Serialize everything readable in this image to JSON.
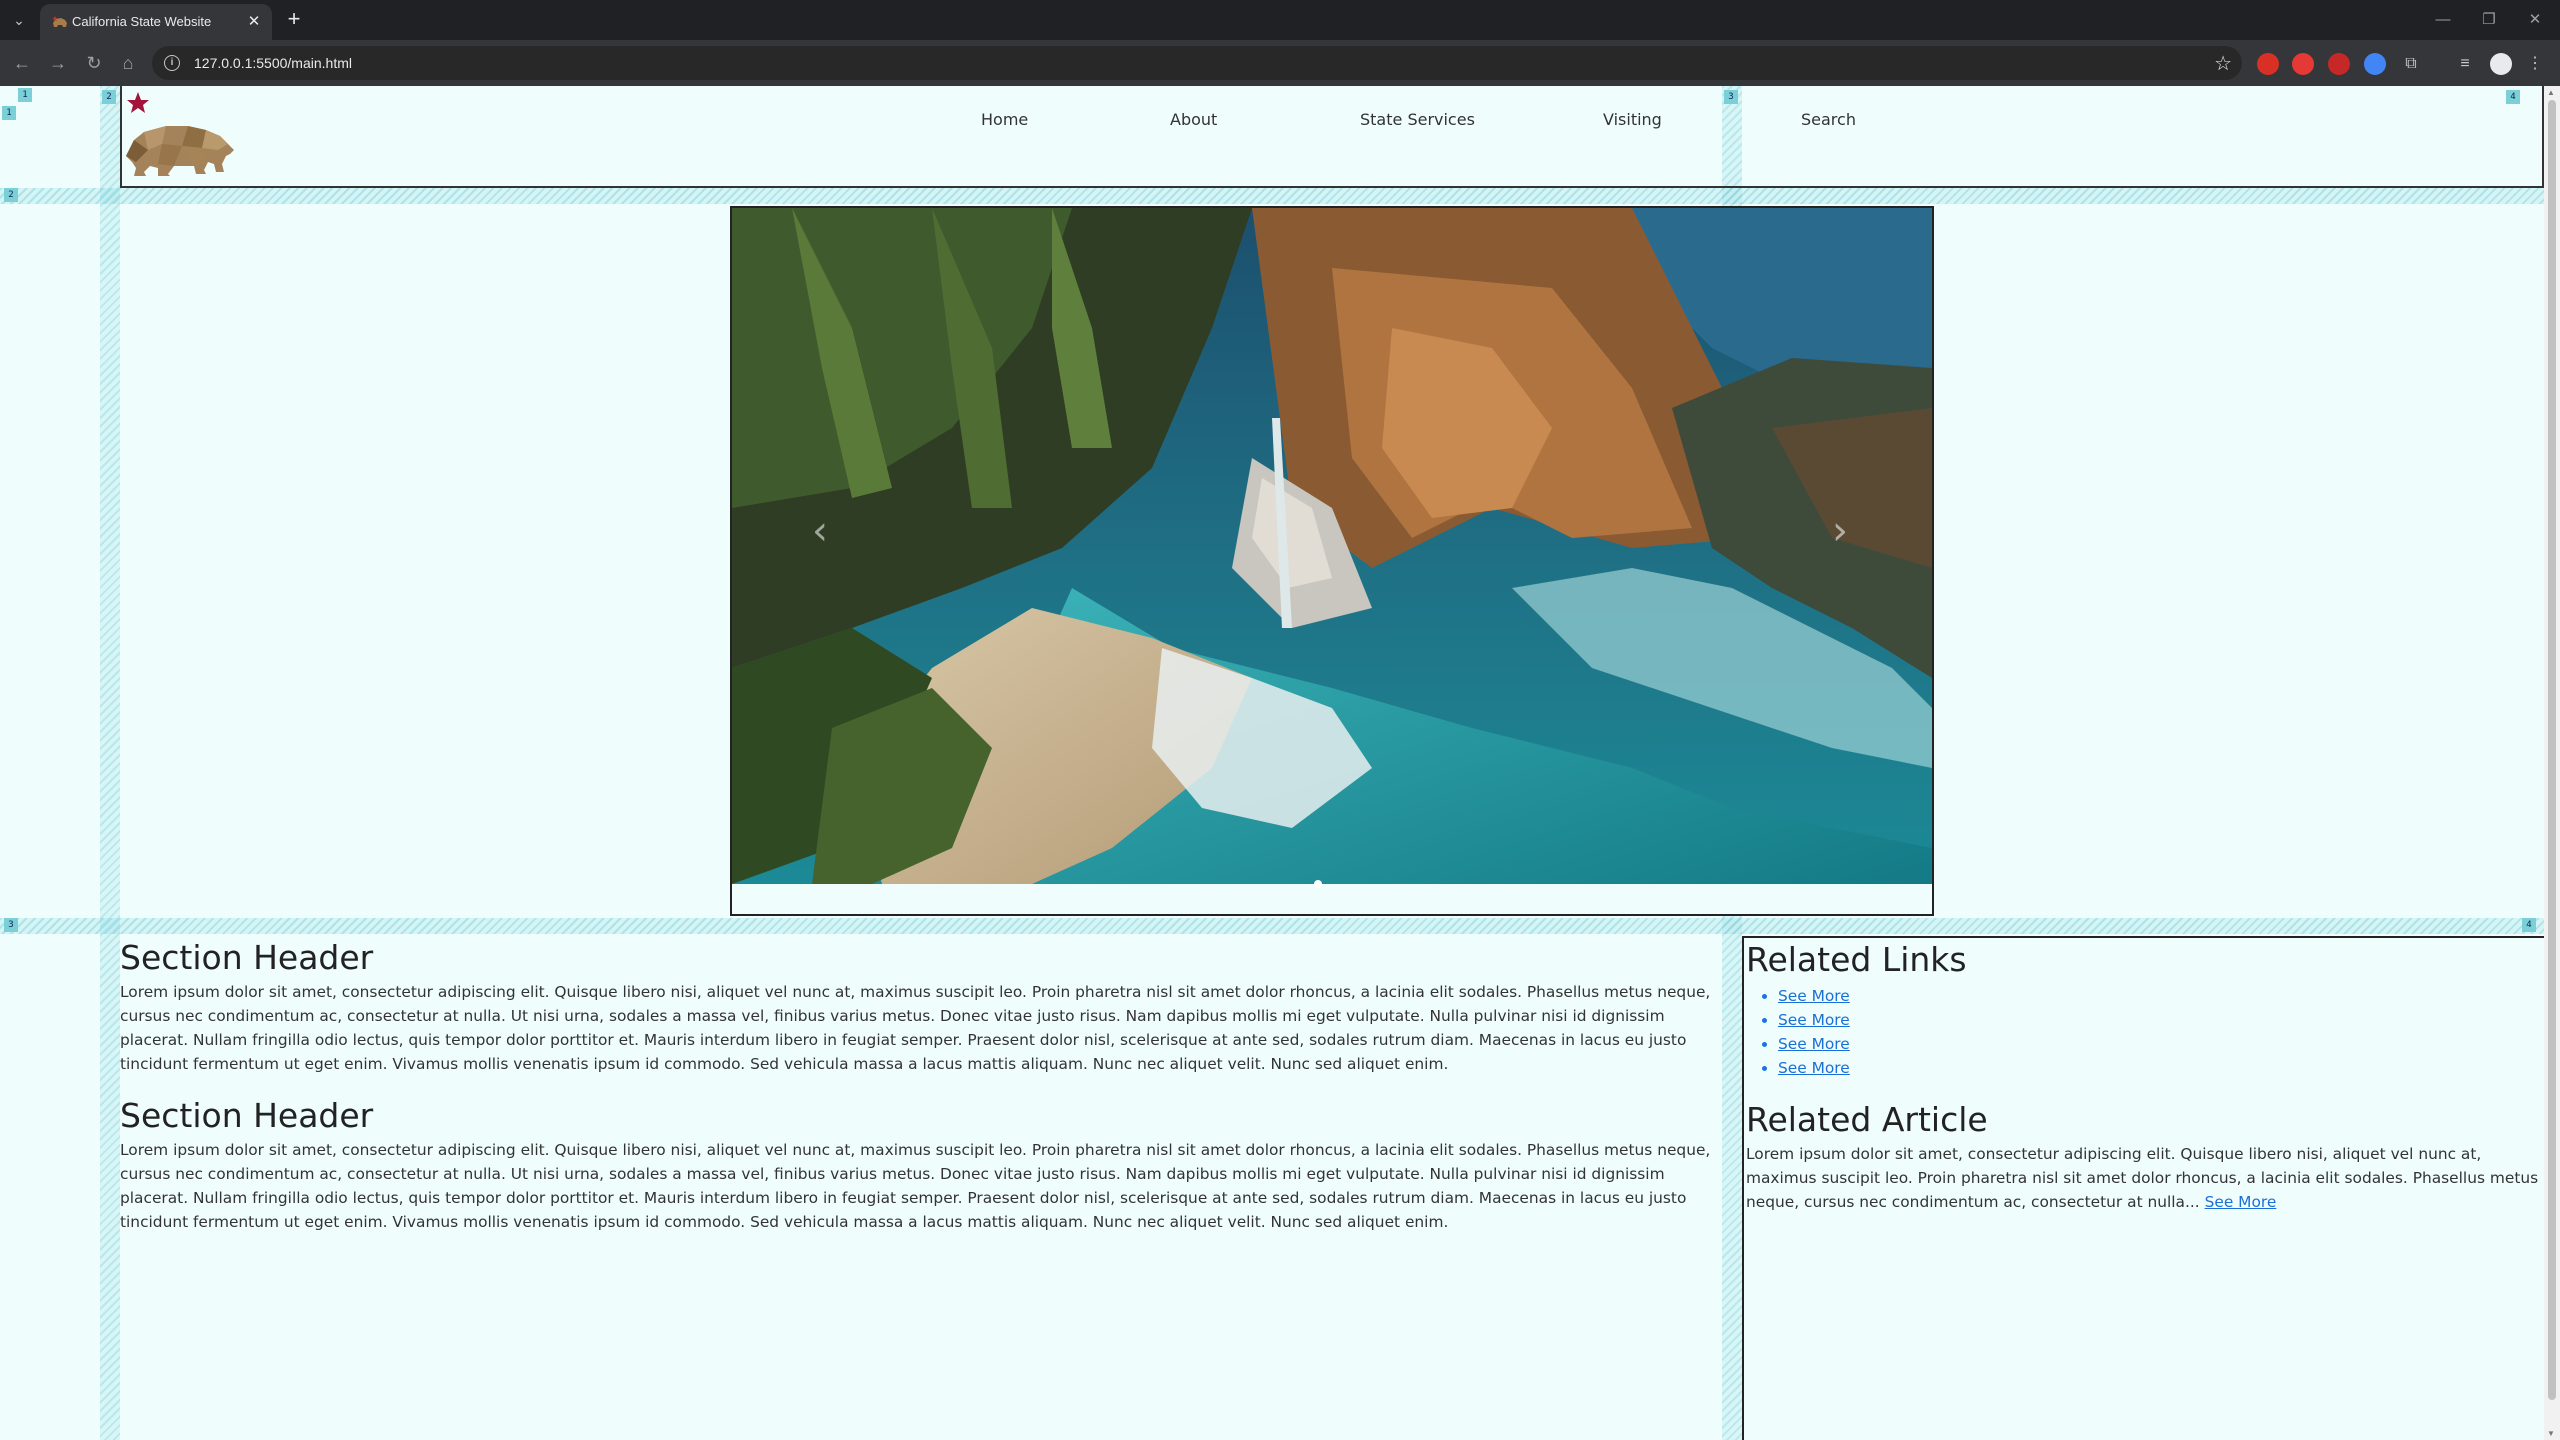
{
  "browser": {
    "tab_title": "California State Website",
    "url": "127.0.0.1:5500/main.html"
  },
  "nav": {
    "items": [
      {
        "label": "Home"
      },
      {
        "label": "About"
      },
      {
        "label": "State Services"
      },
      {
        "label": "Visiting"
      },
      {
        "label": "Search"
      }
    ]
  },
  "carousel": {
    "prev_glyph": "‹",
    "next_glyph": "›"
  },
  "main": {
    "sections": [
      {
        "header": "Section Header",
        "body": "Lorem ipsum dolor sit amet, consectetur adipiscing elit. Quisque libero nisi, aliquet vel nunc at, maximus suscipit leo. Proin pharetra nisl sit amet dolor rhoncus, a lacinia elit sodales. Phasellus metus neque, cursus nec condimentum ac, consectetur at nulla. Ut nisi urna, sodales a massa vel, finibus varius metus. Donec vitae justo risus. Nam dapibus mollis mi eget vulputate. Nulla pulvinar nisi id dignissim placerat. Nullam fringilla odio lectus, quis tempor dolor porttitor et. Mauris interdum libero in feugiat semper. Praesent dolor nisl, scelerisque at ante sed, sodales rutrum diam. Maecenas in lacus eu justo tincidunt fermentum ut eget enim. Vivamus mollis venenatis ipsum id commodo. Sed vehicula massa a lacus mattis aliquam. Nunc nec aliquet velit. Nunc sed aliquet enim."
      },
      {
        "header": "Section Header",
        "body": "Lorem ipsum dolor sit amet, consectetur adipiscing elit. Quisque libero nisi, aliquet vel nunc at, maximus suscipit leo. Proin pharetra nisl sit amet dolor rhoncus, a lacinia elit sodales. Phasellus metus neque, cursus nec condimentum ac, consectetur at nulla. Ut nisi urna, sodales a massa vel, finibus varius metus. Donec vitae justo risus. Nam dapibus mollis mi eget vulputate. Nulla pulvinar nisi id dignissim placerat. Nullam fringilla odio lectus, quis tempor dolor porttitor et. Mauris interdum libero in feugiat semper. Praesent dolor nisl, scelerisque at ante sed, sodales rutrum diam. Maecenas in lacus eu justo tincidunt fermentum ut eget enim. Vivamus mollis venenatis ipsum id commodo. Sed vehicula massa a lacus mattis aliquam. Nunc nec aliquet velit. Nunc sed aliquet enim."
      }
    ]
  },
  "aside": {
    "related_links_title": "Related Links",
    "links": [
      {
        "label": "See More"
      },
      {
        "label": "See More"
      },
      {
        "label": "See More"
      },
      {
        "label": "See More"
      }
    ],
    "related_article_title": "Related Article",
    "article_text": "Lorem ipsum dolor sit amet, consectetur adipiscing elit. Quisque libero nisi, aliquet vel nunc at, maximus suscipit leo. Proin pharetra nisl sit amet dolor rhoncus, a lacinia elit sodales. Phasellus metus neque, cursus nec condimentum ac, consectetur at nulla...",
    "article_link": "See More"
  },
  "grid_labels": {
    "c1": "1",
    "c2": "2",
    "c3": "3",
    "c4": "4",
    "r1": "1",
    "r2": "2",
    "r3": "3",
    "r4": "4"
  },
  "colors": {
    "page_bg": "#effefd",
    "link": "#1a6fd6",
    "grid_overlay": "#7bd0d8"
  }
}
